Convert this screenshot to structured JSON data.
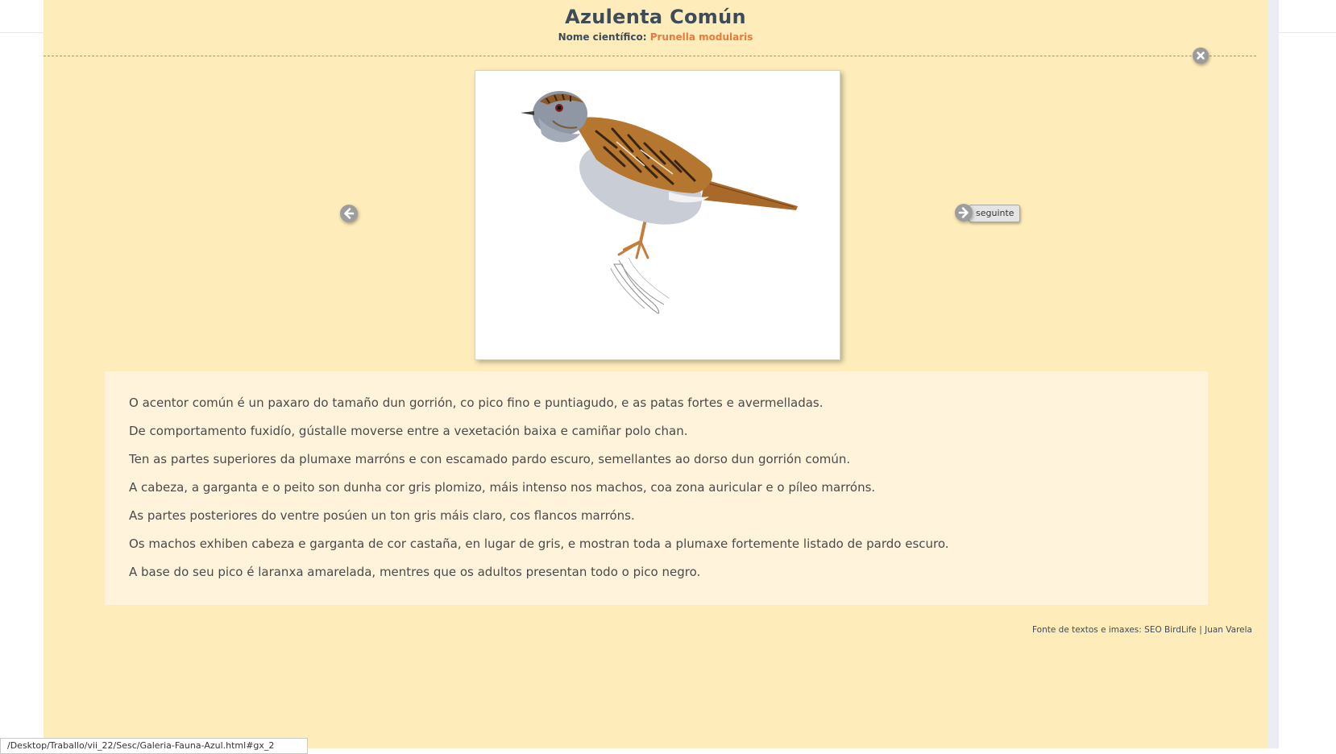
{
  "header": {
    "title": "Azulenta Común",
    "scientific_label": "Nome científico:",
    "scientific_name": "Prunella modularis"
  },
  "controls": {
    "close_icon": "close-icon",
    "prev_icon": "arrow-left-icon",
    "next_icon": "arrow-right-icon",
    "next_label": "seguinte"
  },
  "image": {
    "subject": "bird-illustration"
  },
  "description": {
    "paragraphs": [
      "O acentor común é un paxaro do tamaño dun gorrión, co pico fino e puntiagudo, e as patas fortes e avermelladas.",
      "De comportamento fuxidío, gústalle moverse entre a vexetación baixa e camiñar polo chan.",
      "Ten as partes superiores da plumaxe marróns e con escamado pardo escuro, semellantes ao dorso dun gorrión común.",
      "A cabeza, a garganta e o peito son dunha cor gris plomizo, máis intenso nos machos, coa zona auricular e o píleo marróns.",
      "As partes posteriores do ventre posúen un ton gris máis claro, cos flancos marróns.",
      "Os machos exhiben cabeza e garganta de cor castaña, en lugar de gris, e mostran toda a plumaxe fortemente listado de pardo escuro.",
      "A base do seu pico é laranxa amarelada, mentres que os adultos presentan todo o pico negro."
    ]
  },
  "footer": {
    "credit": "Fonte de textos e imaxes: SEO BirdLife | Juan Varela"
  },
  "status_bar": {
    "text": "/Desktop/Traballo/vii_22/Sesc/Galeria-Fauna-Azul.html#gx_2"
  },
  "colors": {
    "panel_bg": "#feedbb",
    "desc_bg": "#fff3dc",
    "title": "#3d4c59",
    "accent": "#e87a3c",
    "icon_gray": "#9b9b9b"
  }
}
